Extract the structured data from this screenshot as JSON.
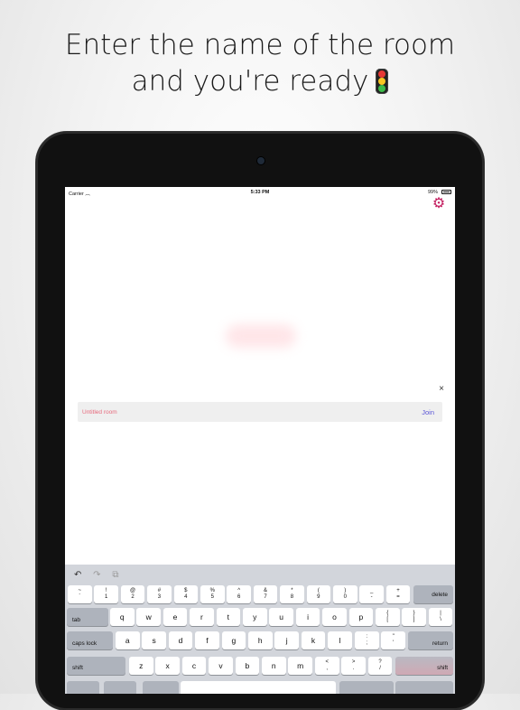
{
  "headline": {
    "line1": "Enter the name of the room",
    "line2": "and you're ready"
  },
  "statusbar": {
    "carrier": "Carrier",
    "time": "5:33 PM",
    "battery": "99%"
  },
  "room": {
    "placeholder": "Untitled room",
    "join_label": "Join",
    "close_glyph": "×"
  },
  "icons": {
    "settings": "gear-icon",
    "headline_emoji": "traffic-light-icon"
  },
  "colors": {
    "accent": "#c2185b",
    "join": "#5a55d6",
    "placeholder": "#e76a7d"
  },
  "keyboard": {
    "tools": [
      "↶",
      "↷",
      "⧉"
    ],
    "row1": [
      {
        "top": "~",
        "bottom": "`"
      },
      {
        "top": "!",
        "bottom": "1"
      },
      {
        "top": "@",
        "bottom": "2"
      },
      {
        "top": "#",
        "bottom": "3"
      },
      {
        "top": "$",
        "bottom": "4"
      },
      {
        "top": "%",
        "bottom": "5"
      },
      {
        "top": "^",
        "bottom": "6"
      },
      {
        "top": "&",
        "bottom": "7"
      },
      {
        "top": "*",
        "bottom": "8"
      },
      {
        "top": "(",
        "bottom": "9"
      },
      {
        "top": ")",
        "bottom": "0"
      },
      {
        "top": "_",
        "bottom": "-"
      },
      {
        "top": "+",
        "bottom": "="
      }
    ],
    "delete": "delete",
    "tab": "tab",
    "row2": [
      "q",
      "w",
      "e",
      "r",
      "t",
      "y",
      "u",
      "i",
      "o",
      "p"
    ],
    "row2_extra": [
      {
        "top": "{",
        "bottom": "["
      },
      {
        "top": "}",
        "bottom": "]"
      },
      {
        "top": "|",
        "bottom": "\\"
      }
    ],
    "caps": "caps lock",
    "row3": [
      "a",
      "s",
      "d",
      "f",
      "g",
      "h",
      "j",
      "k",
      "l"
    ],
    "row3_extra": [
      {
        "top": ":",
        "bottom": ";"
      },
      {
        "top": "\"",
        "bottom": "'"
      }
    ],
    "return": "return",
    "shift_left": "shift",
    "row4": [
      "z",
      "x",
      "c",
      "v",
      "b",
      "n",
      "m"
    ],
    "row4_extra": [
      {
        "top": "<",
        "bottom": ","
      },
      {
        "top": ">",
        "bottom": "."
      },
      {
        "top": "?",
        "bottom": "/"
      }
    ],
    "shift_right": "shift"
  }
}
